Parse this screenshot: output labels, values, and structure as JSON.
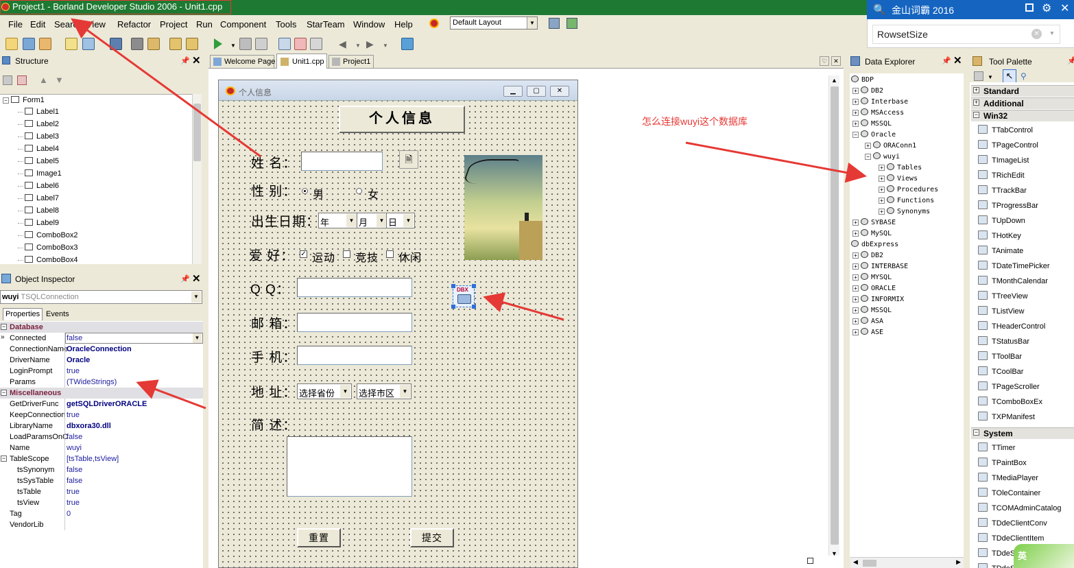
{
  "window": {
    "title": "Project1 - Borland Developer Studio 2006 - Unit1.cpp"
  },
  "menubar": {
    "items": [
      "File",
      "Edit",
      "Search",
      "View",
      "Refactor",
      "Project",
      "Run",
      "Component",
      "Tools",
      "StarTeam",
      "Window",
      "Help"
    ]
  },
  "layout_combo": {
    "value": "Default Layout"
  },
  "structure": {
    "title": "Structure",
    "root": "Form1",
    "items": [
      "Label1",
      "Label2",
      "Label3",
      "Label4",
      "Label5",
      "Image1",
      "Label6",
      "Label7",
      "Label8",
      "Label9",
      "ComboBox2",
      "ComboBox3",
      "ComboBox4"
    ]
  },
  "object_inspector": {
    "title": "Object Inspector",
    "selected_name": "wuyi",
    "selected_type": "TSQLConnection",
    "tabs": [
      "Properties",
      "Events"
    ],
    "rows": [
      {
        "name": "Database",
        "value": "",
        "kind": "cat"
      },
      {
        "name": "Connected",
        "value": "false",
        "kind": "combo"
      },
      {
        "name": "ConnectionName",
        "value": "OracleConnection",
        "kind": "bold"
      },
      {
        "name": "DriverName",
        "value": "Oracle",
        "kind": "bold"
      },
      {
        "name": "LoginPrompt",
        "value": "true",
        "kind": "val"
      },
      {
        "name": "Params",
        "value": "(TWideStrings)",
        "kind": "val"
      },
      {
        "name": "Miscellaneous",
        "value": "",
        "kind": "cat"
      },
      {
        "name": "GetDriverFunc",
        "value": "getSQLDriverORACLE",
        "kind": "bold"
      },
      {
        "name": "KeepConnection",
        "value": "true",
        "kind": "val"
      },
      {
        "name": "LibraryName",
        "value": "dbxora30.dll",
        "kind": "bold"
      },
      {
        "name": "LoadParamsOnC",
        "value": "false",
        "kind": "val"
      },
      {
        "name": "Name",
        "value": "wuyi",
        "kind": "val"
      },
      {
        "name": "TableScope",
        "value": "[tsTable,tsView]",
        "kind": "val"
      },
      {
        "name": "tsSynonym",
        "value": "false",
        "kind": "sub"
      },
      {
        "name": "tsSysTable",
        "value": "false",
        "kind": "sub"
      },
      {
        "name": "tsTable",
        "value": "true",
        "kind": "sub"
      },
      {
        "name": "tsView",
        "value": "true",
        "kind": "sub"
      },
      {
        "name": "Tag",
        "value": "0",
        "kind": "val"
      },
      {
        "name": "VendorLib",
        "value": "",
        "kind": "val"
      }
    ]
  },
  "editor": {
    "tabs": [
      "Welcome Page",
      "Unit1.cpp",
      "Project1"
    ]
  },
  "form": {
    "caption": "个人信息",
    "header_button": "个人信息",
    "name_label": "姓 名：",
    "gender_label": "性 别：",
    "male": "男",
    "female": "女",
    "birth_label": "出生日期：",
    "year": "年",
    "month": "月",
    "day": "日",
    "hobby_label": "爱 好：",
    "hobbies": [
      "运动",
      "竞技",
      "休闲"
    ],
    "qq_label": "Q Q：",
    "email_label": "邮 箱：",
    "phone_label": "手 机：",
    "address_label": "地 址：",
    "province": "选择省份",
    "city": "选择市区",
    "intro_label": "简 述：",
    "reset": "重置",
    "submit": "提交",
    "dbx_component": "DBX"
  },
  "annotation": {
    "text": "怎么连接wuyi这个数据库"
  },
  "data_explorer": {
    "title": "Data Explorer",
    "items": [
      {
        "label": "BDP",
        "level": 0,
        "kind": "root"
      },
      {
        "label": "DB2",
        "level": 1,
        "kind": "plus"
      },
      {
        "label": "Interbase",
        "level": 1,
        "kind": "plus"
      },
      {
        "label": "MSAccess",
        "level": 1,
        "kind": "plus"
      },
      {
        "label": "MSSQL",
        "level": 1,
        "kind": "plus"
      },
      {
        "label": "Oracle",
        "level": 1,
        "kind": "minus"
      },
      {
        "label": "ORAConn1",
        "level": 2,
        "kind": "plus"
      },
      {
        "label": "wuyi",
        "level": 2,
        "kind": "minus"
      },
      {
        "label": "Tables",
        "level": 3,
        "kind": "plus"
      },
      {
        "label": "Views",
        "level": 3,
        "kind": "plus"
      },
      {
        "label": "Procedures",
        "level": 3,
        "kind": "plus"
      },
      {
        "label": "Functions",
        "level": 3,
        "kind": "plus"
      },
      {
        "label": "Synonyms",
        "level": 3,
        "kind": "plus"
      },
      {
        "label": "SYBASE",
        "level": 1,
        "kind": "plus"
      },
      {
        "label": "MySQL",
        "level": 1,
        "kind": "plus"
      },
      {
        "label": "dbExpress",
        "level": 0,
        "kind": "root"
      },
      {
        "label": "DB2",
        "level": 1,
        "kind": "plus"
      },
      {
        "label": "INTERBASE",
        "level": 1,
        "kind": "plus"
      },
      {
        "label": "MYSQL",
        "level": 1,
        "kind": "plus"
      },
      {
        "label": "ORACLE",
        "level": 1,
        "kind": "plus"
      },
      {
        "label": "INFORMIX",
        "level": 1,
        "kind": "plus"
      },
      {
        "label": "MSSQL",
        "level": 1,
        "kind": "plus"
      },
      {
        "label": "ASA",
        "level": 1,
        "kind": "plus"
      },
      {
        "label": "ASE",
        "level": 1,
        "kind": "plus"
      }
    ]
  },
  "tool_palette": {
    "title": "Tool Palette",
    "categories": [
      {
        "name": "Standard",
        "expanded": false,
        "items": []
      },
      {
        "name": "Additional",
        "expanded": false,
        "items": []
      },
      {
        "name": "Win32",
        "expanded": true,
        "items": [
          "TTabControl",
          "TPageControl",
          "TImageList",
          "TRichEdit",
          "TTrackBar",
          "TProgressBar",
          "TUpDown",
          "THotKey",
          "TAnimate",
          "TDateTimePicker",
          "TMonthCalendar",
          "TTreeView",
          "TListView",
          "THeaderControl",
          "TStatusBar",
          "TToolBar",
          "TCoolBar",
          "TPageScroller",
          "TComboBoxEx",
          "TXPManifest"
        ]
      },
      {
        "name": "System",
        "expanded": true,
        "items": [
          "TTimer",
          "TPaintBox",
          "TMediaPlayer",
          "TOleContainer",
          "TCOMAdminCatalog",
          "TDdeClientConv",
          "TDdeClientItem",
          "TDdeS",
          "TDdeS"
        ]
      }
    ]
  },
  "kingsoft": {
    "title": "金山词霸 2016",
    "query": "RowsetSize",
    "ime": "英"
  },
  "colors": {
    "titlebar": "#1e7a32",
    "annotation": "#e53935",
    "oi_category": "#7a1f3d",
    "accent_blue": "#1565c0"
  }
}
